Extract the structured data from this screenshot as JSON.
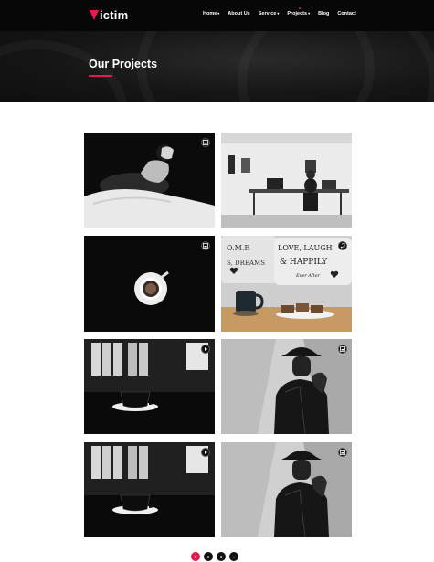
{
  "brand": {
    "name": "ictim",
    "accent": "#e8194f"
  },
  "nav": {
    "items": [
      {
        "label": "Home",
        "has_dropdown": true
      },
      {
        "label": "About Us",
        "has_dropdown": false
      },
      {
        "label": "Service",
        "has_dropdown": true
      },
      {
        "label": "Projects",
        "has_dropdown": true,
        "active": true
      },
      {
        "label": "Blog",
        "has_dropdown": false
      },
      {
        "label": "Contact",
        "has_dropdown": false
      }
    ]
  },
  "banner": {
    "title": "Our Projects"
  },
  "projects": [
    {
      "subject": "woman lying in bed, black and white",
      "badge_icon": "gallery-icon"
    },
    {
      "subject": "person working at desk in white office",
      "badge_icon": "none"
    },
    {
      "subject": "coffee cup on black surface, top view",
      "badge_icon": "gallery-icon"
    },
    {
      "subject": "mug and cupcakes with decorative pillows",
      "badge_icon": "music-icon",
      "pillow_text": [
        "O.M.E",
        "LOVE, LAUGH",
        "& HAPPILY",
        "S, DREAMS",
        "Ever After"
      ]
    },
    {
      "subject": "espresso cup on dark table with binders",
      "badge_icon": "video-icon"
    },
    {
      "subject": "man in hat and leather jacket",
      "badge_icon": "gallery-icon"
    },
    {
      "subject": "espresso cup on dark table with binders",
      "badge_icon": "video-icon"
    },
    {
      "subject": "man in hat and leather jacket",
      "badge_icon": "gallery-icon"
    }
  ],
  "pagination": {
    "pages": [
      "1",
      "2",
      "3"
    ],
    "current": "1",
    "next_label": "»"
  }
}
